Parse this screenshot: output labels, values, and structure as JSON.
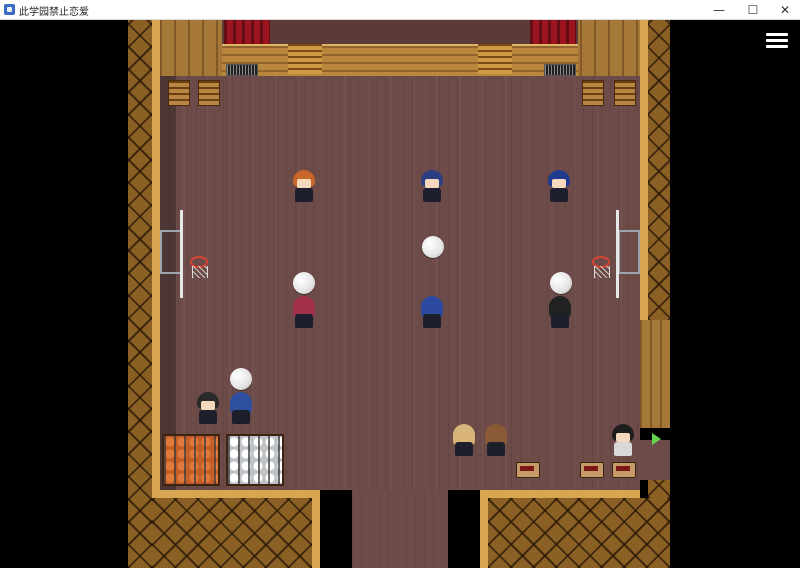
{
  "window": {
    "title": "此学园禁止恋爱",
    "minimize_glyph": "—",
    "maximize_glyph": "☐",
    "close_glyph": "✕"
  },
  "ui": {
    "menu_icon": "hamburger-menu-icon",
    "exit_icon": "green-arrow-right-icon"
  },
  "colors": {
    "floor": "#6d4b48",
    "wall": "#8a6024",
    "trim": "#d8a653",
    "curtain": "#9b1420",
    "exit_arrow": "#64d24a"
  },
  "scene": {
    "location": "gymnasium",
    "hoops": [
      "left-hoop",
      "right-hoop"
    ],
    "characters": [
      {
        "id": "npc-orange-hair",
        "hair": "#c8662a",
        "facing": "front"
      },
      {
        "id": "npc-navy-hair-center",
        "hair": "#2c3f85",
        "facing": "front"
      },
      {
        "id": "npc-navy-hair-right",
        "hair": "#203a8f",
        "facing": "front"
      },
      {
        "id": "npc-red-hair",
        "hair": "#a3304a",
        "facing": "back"
      },
      {
        "id": "npc-blue-hair-center",
        "hair": "#2b4aa0",
        "facing": "back"
      },
      {
        "id": "npc-black-hair-right",
        "hair": "#222222",
        "facing": "back"
      },
      {
        "id": "npc-black-hair-left",
        "hair": "#2a2a2a",
        "facing": "front"
      },
      {
        "id": "npc-blue-hair-left",
        "hair": "#2e4f9e",
        "facing": "back"
      },
      {
        "id": "npc-blonde-hair",
        "hair": "#d9b47a",
        "facing": "back"
      },
      {
        "id": "npc-brown-hair",
        "hair": "#8a5a36",
        "facing": "back"
      },
      {
        "id": "player",
        "hair": "#1e1e1e",
        "facing": "front"
      }
    ]
  }
}
